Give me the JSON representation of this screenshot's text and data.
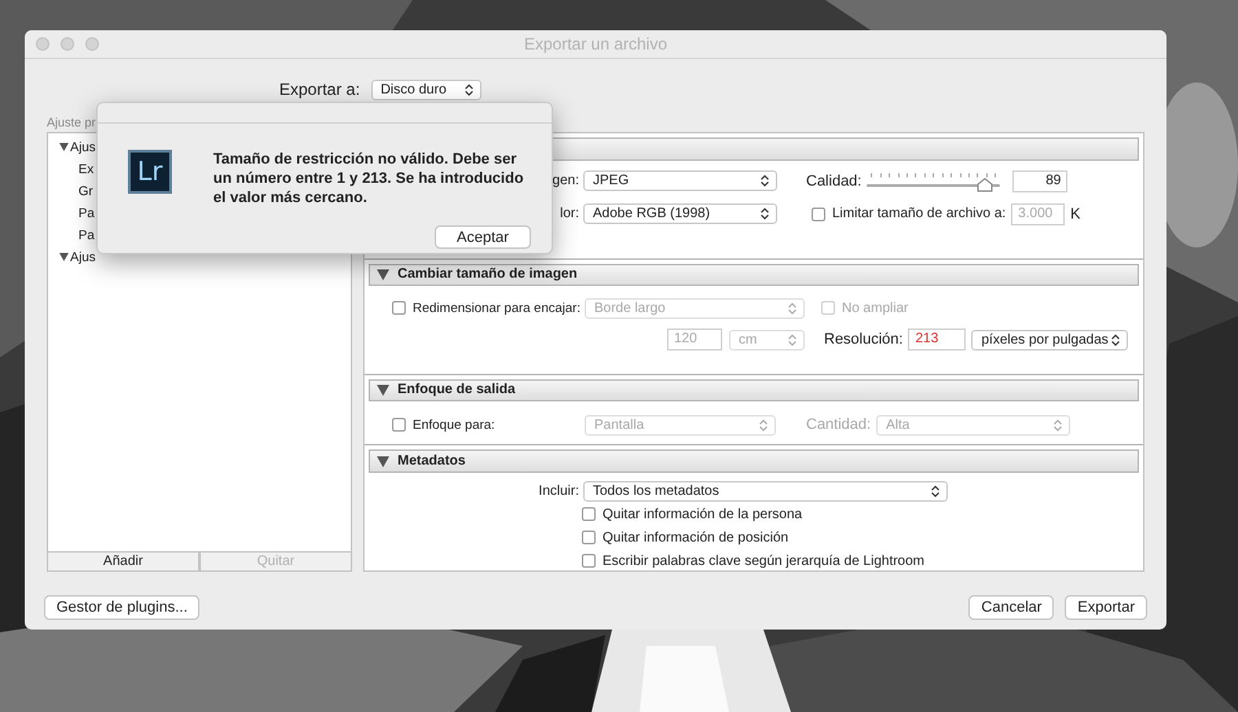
{
  "window": {
    "title": "Exportar un archivo"
  },
  "export_to": {
    "label": "Exportar a:",
    "value": "Disco duro"
  },
  "presets": {
    "label": "Ajuste pr",
    "items": [
      {
        "label": "Ajus",
        "expanded": true,
        "children": [
          {
            "label": "Ex"
          },
          {
            "label": "Gr"
          },
          {
            "label": "Pa"
          },
          {
            "label": "Pa"
          }
        ]
      },
      {
        "label": "Ajus",
        "expanded": true
      }
    ],
    "buttons": [
      {
        "label": "Añadir",
        "disabled": false
      },
      {
        "label": "Quitar",
        "disabled": true
      }
    ]
  },
  "file_settings": {
    "format_label": "gen:",
    "format": "JPEG",
    "quality_label": "Calidad:",
    "quality": {
      "level": 0.88
    },
    "quality_value": "89",
    "color_space_label": "lor:",
    "color_space": "Adobe RGB (1998)",
    "limit_size": {
      "label": "Limitar tamaño de archivo a:",
      "checked": false
    },
    "limit_value": "3.000",
    "limit_unit": "K"
  },
  "resize": {
    "title": "Cambiar tamaño de imagen",
    "expanded": true,
    "fit": {
      "label": "Redimensionar para encajar:",
      "checked": false
    },
    "fit_mode": "Borde largo",
    "no_enlarge": {
      "label": "No ampliar",
      "checked": false
    },
    "size_value": "120",
    "size_unit": "cm",
    "resolution_label": "Resolución:",
    "resolution": "213",
    "resolution_invalid": true,
    "resolution_unit": "píxeles por pulgadas"
  },
  "sharpening": {
    "title": "Enfoque de salida",
    "expanded": true,
    "sharpen": {
      "label": "Enfoque para:",
      "checked": false
    },
    "target": "Pantalla",
    "amount_label": "Cantidad:",
    "amount": "Alta"
  },
  "metadata": {
    "title": "Metadatos",
    "expanded": true,
    "include_label": "Incluir:",
    "include": "Todos los metadatos",
    "options": [
      {
        "label": "Quitar información de la persona",
        "checked": false
      },
      {
        "label": "Quitar información de posición",
        "checked": false
      },
      {
        "label": "Escribir palabras clave según jerarquía de Lightroom",
        "checked": false
      }
    ]
  },
  "plugin_manager": "Gestor de plugins...",
  "actions": [
    "Cancelar",
    "Exportar"
  ],
  "alert": {
    "app_icon": "Lr",
    "message": "Tamaño de restricción no válido. Debe ser\nun número entre 1 y 213. Se ha introducido\nel valor más cercano.",
    "button": "Aceptar"
  }
}
